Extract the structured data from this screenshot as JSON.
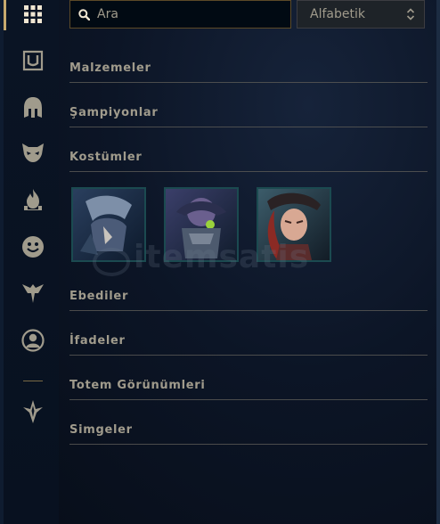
{
  "search": {
    "placeholder": "Ara"
  },
  "sort": {
    "selected": "Alfabetik"
  },
  "sidebar": {
    "icons": [
      "grid-icon",
      "item-chest-icon",
      "champion-helmet-icon",
      "skin-mask-icon",
      "eternal-flame-icon",
      "emote-face-icon",
      "totem-ward-icon",
      "summoner-icon-portrait",
      "loot-crest-icon"
    ]
  },
  "sections": [
    {
      "title": "Malzemeler"
    },
    {
      "title": "Şampiyonlar"
    },
    {
      "title": "Kostümler"
    },
    {
      "title": "Ebediler"
    },
    {
      "title": "İfadeler"
    },
    {
      "title": "Totem Görünümleri"
    },
    {
      "title": "Simgeler"
    }
  ],
  "skins": [
    {
      "name": "skin-thumbnail-1"
    },
    {
      "name": "skin-thumbnail-2"
    },
    {
      "name": "skin-thumbnail-3"
    }
  ],
  "watermark": {
    "text": "itemsatis"
  },
  "colors": {
    "accent_gold": "#c8aa6e",
    "text_muted": "#a09b8c",
    "divider": "#5b5a56",
    "thumb_border": "#1b4a50",
    "background": "#0c1526"
  }
}
